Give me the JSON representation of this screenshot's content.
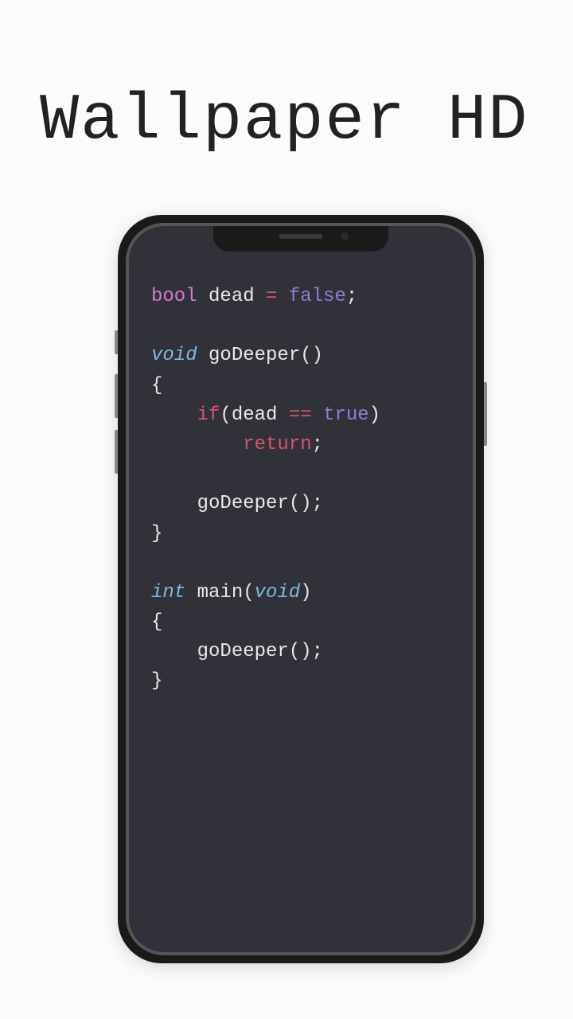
{
  "header": {
    "title": "Wallpaper HD"
  },
  "code": {
    "tok_bool": "bool",
    "tok_dead": " dead ",
    "tok_eq": "=",
    "tok_sp1": " ",
    "tok_false": "false",
    "tok_semi1": ";",
    "tok_void": "void",
    "tok_godeeper_decl": " goDeeper()",
    "tok_lbrace1": "{",
    "tok_indent1": "    ",
    "tok_if": "if",
    "tok_ifcond_open": "(dead ",
    "tok_eqeq": "==",
    "tok_sp2": " ",
    "tok_true": "true",
    "tok_ifcond_close": ")",
    "tok_indent2": "        ",
    "tok_return": "return",
    "tok_semi2": ";",
    "tok_indent3": "    ",
    "tok_godeeper_call1": "goDeeper();",
    "tok_rbrace1": "}",
    "tok_int": "int",
    "tok_main_open": " main(",
    "tok_void2": "void",
    "tok_main_close": ")",
    "tok_lbrace2": "{",
    "tok_indent4": "    ",
    "tok_godeeper_call2": "goDeeper();",
    "tok_rbrace2": "}"
  }
}
